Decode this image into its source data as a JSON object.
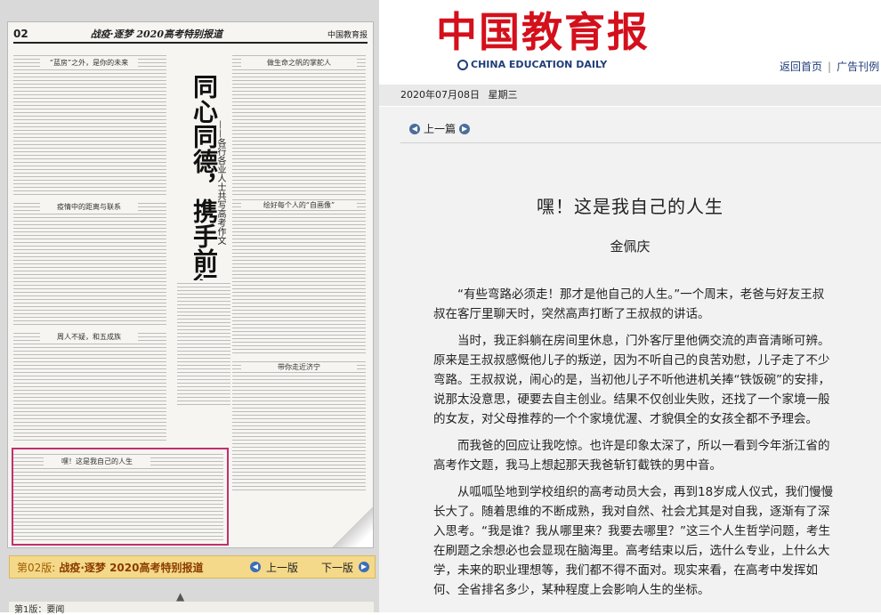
{
  "site": {
    "logo_cn": "中国教育报",
    "logo_en": "CHINA EDUCATION DAILY",
    "links": [
      "返回首页",
      "广告刊例"
    ],
    "date": "2020年07月08日",
    "weekday": "星期三"
  },
  "paper": {
    "page_number": "02",
    "header_title": "战疫·逐梦 2020高考特别报道",
    "header_logo": "中国教育报",
    "headline": "同心同德，携手前行",
    "subheadline": "——各行各业人士共写高考作文",
    "articles": [
      "“蓝房”之外，是你的未来",
      "做生命之帆的掌舵人",
      "疫情中的距离与联系",
      "绘好每个人的“自画像”",
      "周人不疑，和五成族",
      "带你走近济宁",
      "嘿！这是我自己的人生"
    ]
  },
  "edition_bar": {
    "edition": "第02版:",
    "edition_name": "战疫·逐梦 2020高考特别报道",
    "prev_label": "上一版",
    "next_label": "下一版"
  },
  "bottom": {
    "partial_label": "第1版：要闻"
  },
  "article_nav": {
    "prev_label": "上一篇"
  },
  "article": {
    "title": "嘿！这是我自己的人生",
    "author": "金佩庆",
    "paragraphs": [
      "“有些弯路必须走！那才是他自己的人生。”一个周末，老爸与好友王叔叔在客厅里聊天时，突然高声打断了王叔叔的讲话。",
      "当时，我正斜躺在房间里休息，门外客厅里他俩交流的声音清晰可辨。原来是王叔叔感慨他儿子的叛逆，因为不听自己的良苦劝慰，儿子走了不少弯路。王叔叔说，闹心的是，当初他儿子不听他进机关捧“铁饭碗”的安排，说那太没意思，硬要去自主创业。结果不仅创业失败，还找了一个家境一般的女友，对父母推荐的一个个家境优渥、才貌俱全的女孩全都不予理会。",
      "而我爸的回应让我吃惊。也许是印象太深了，所以一看到今年浙江省的高考作文题，我马上想起那天我爸斩钉截铁的男中音。",
      "从呱呱坠地到学校组织的高考动员大会，再到18岁成人仪式，我们慢慢长大了。随着思维的不断成熟，我对自然、社会尤其是对自我，逐渐有了深入思考。“我是谁？我从哪里来？我要去哪里？”这三个人生哲学问题，考生在刷题之余想必也会显现在脑海里。高考结束以后，选什么专业，上什么大学，未来的职业理想等，我们都不得不面对。现实来看，在高考中发挥如何、全省排名多少，某种程度上会影响人生的坐标。"
    ]
  },
  "colors": {
    "logo_red": "#d3101b",
    "link_blue": "#1f3d7a",
    "highlight_box": "#c0306e",
    "edition_bar_bg": "#f5d98a"
  }
}
